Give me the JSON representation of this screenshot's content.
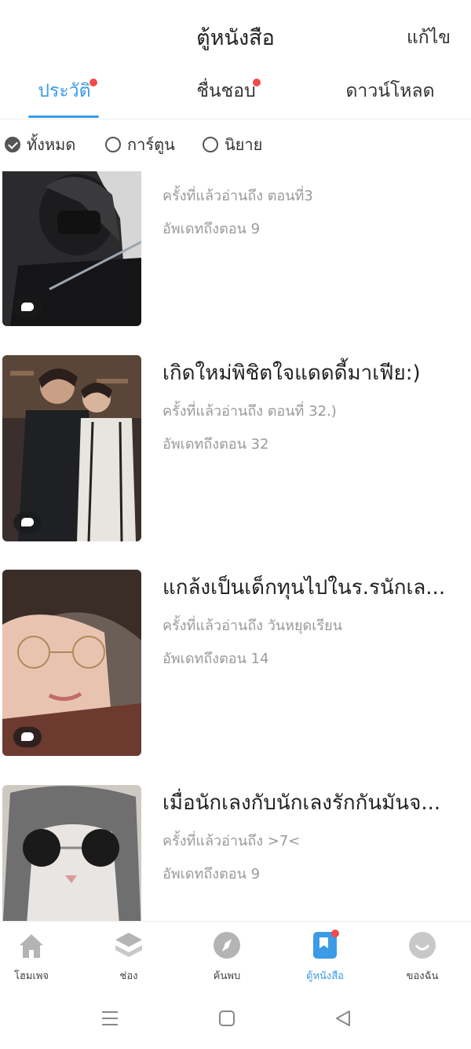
{
  "header": {
    "title": "ตู้หนังสือ",
    "edit_label": "แก้ไข"
  },
  "tabs": [
    {
      "label": "ประวัติ",
      "active": true,
      "dot": true
    },
    {
      "label": "ชื่นชอบ",
      "active": false,
      "dot": true
    },
    {
      "label": "ดาวน์โหลด",
      "active": false,
      "dot": false
    }
  ],
  "filters": [
    {
      "label": "ทั้งหมด",
      "checked": true
    },
    {
      "label": "การ์ตูน",
      "checked": false
    },
    {
      "label": "นิยาย",
      "checked": false
    }
  ],
  "items": [
    {
      "title": "",
      "last_read": "ครั้งที่แล้วอ่านถึง ตอนที่3",
      "updated": "อัพเดทถึงตอน 9"
    },
    {
      "title": "เกิดใหม่พิชิตใจแดดดี้มาเฟีย:)",
      "last_read": "ครั้งที่แล้วอ่านถึง ตอนที่ 32.)",
      "updated": "อัพเดทถึงตอน 32"
    },
    {
      "title": "แกล้งเป็นเด็กทุนไปในร.รนักเล...",
      "last_read": "ครั้งที่แล้วอ่านถึง วันหยุดเรียน",
      "updated": "อัพเดทถึงตอน 14"
    },
    {
      "title": "เมื่อนักเลงกับนักเลงรักกันมันจ...",
      "last_read": "ครั้งที่แล้วอ่านถึง >7<",
      "updated": "อัพเดทถึงตอน 9"
    }
  ],
  "bottom_nav": [
    {
      "label": "โฮมเพจ",
      "icon": "home-icon"
    },
    {
      "label": "ช่อง",
      "icon": "layers-icon"
    },
    {
      "label": "ค้นพบ",
      "icon": "compass-icon"
    },
    {
      "label": "ตู้หนังสือ",
      "icon": "bookshelf-icon",
      "active": true
    },
    {
      "label": "ของฉัน",
      "icon": "profile-icon"
    }
  ],
  "colors": {
    "accent": "#3b9be6",
    "badge": "#f24a4a",
    "muted": "#9a9a9a"
  }
}
